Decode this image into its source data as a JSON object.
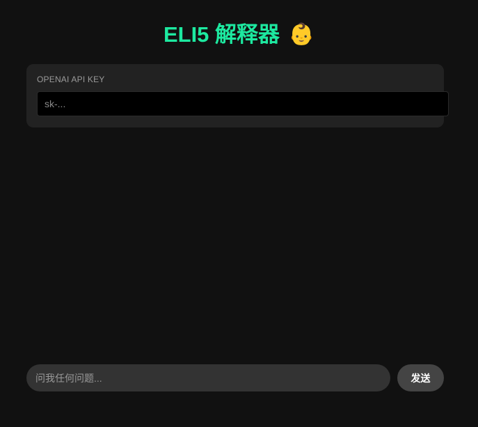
{
  "header": {
    "title": "ELI5 解释器",
    "emoji": "👶"
  },
  "api_key": {
    "label": "OPENAI API KEY",
    "placeholder": "sk-...",
    "value": ""
  },
  "chat": {
    "placeholder": "问我任何问题...",
    "value": "",
    "send_label": "发送"
  },
  "colors": {
    "background": "#111111",
    "accent": "#1de9a0",
    "card": "#222222",
    "input_dark": "#000000",
    "chat_input": "#333333",
    "button": "#444444"
  }
}
